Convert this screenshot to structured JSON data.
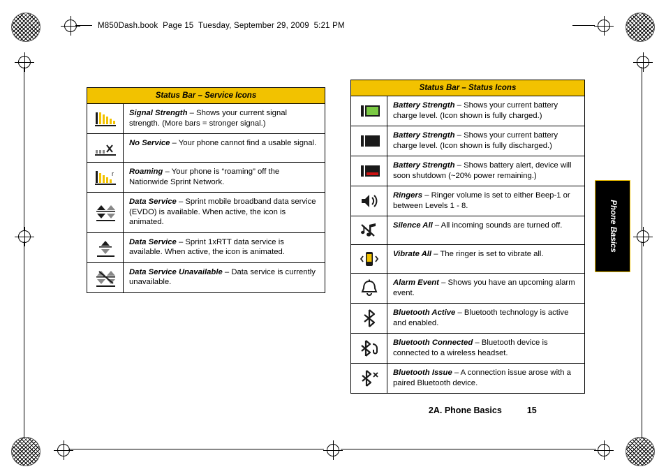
{
  "header": {
    "text": "M850Dash.book  Page 15  Tuesday, September 29, 2009  5:21 PM"
  },
  "footer": {
    "chapter": "2A. Phone Basics",
    "page_number": "15"
  },
  "side_tab": {
    "label": "Phone Basics"
  },
  "tables": [
    {
      "id": "service-icons",
      "caption": "Status Bar – Service Icons",
      "rows": [
        {
          "icon": "signal-strength-icon",
          "term": "Signal Strength",
          "desc": " – Shows your current signal strength. (More bars = stronger signal.)"
        },
        {
          "icon": "no-service-icon",
          "term": "No Service",
          "desc": " – Your phone cannot find a usable signal."
        },
        {
          "icon": "roaming-icon",
          "term": "Roaming",
          "desc": " – Your phone is “roaming” off the Nationwide Sprint Network."
        },
        {
          "icon": "data-service-evdo-icon",
          "term": "Data Service",
          "desc": " – Sprint mobile broadband data service (EVDO) is available. When active, the icon is animated."
        },
        {
          "icon": "data-service-1xrtt-icon",
          "term": "Data Service",
          "desc": " – Sprint 1xRTT data service is available. When active, the icon is animated."
        },
        {
          "icon": "data-service-unavailable-icon",
          "term": "Data Service Unavailable",
          "desc": " – Data service is currently unavailable."
        }
      ]
    },
    {
      "id": "status-icons",
      "caption": "Status Bar – Status Icons",
      "rows": [
        {
          "icon": "battery-full-icon",
          "term": "Battery Strength",
          "desc": " – Shows your current battery charge level. (Icon shown is fully charged.)"
        },
        {
          "icon": "battery-empty-icon",
          "term": "Battery Strength",
          "desc": " – Shows your current battery charge level. (Icon shown is fully discharged.)"
        },
        {
          "icon": "battery-alert-icon",
          "term": "Battery Strength",
          "desc": " – Shows battery alert, device will soon shutdown (~20% power remaining.)"
        },
        {
          "icon": "ringer-icon",
          "term": "Ringers",
          "desc": " – Ringer volume is set to either Beep-1 or between Levels 1 - 8."
        },
        {
          "icon": "silence-all-icon",
          "term": "Silence All",
          "desc": " – All incoming sounds are turned off."
        },
        {
          "icon": "vibrate-all-icon",
          "term": "Vibrate All",
          "desc": " – The ringer is set to vibrate all."
        },
        {
          "icon": "alarm-event-icon",
          "term": "Alarm Event",
          "desc": " – Shows you have an upcoming alarm event."
        },
        {
          "icon": "bluetooth-active-icon",
          "term": "Bluetooth Active",
          "desc": " – Bluetooth technology is active and enabled."
        },
        {
          "icon": "bluetooth-connected-icon",
          "term": "Bluetooth Connected",
          "desc": " – Bluetooth device is connected to a wireless headset."
        },
        {
          "icon": "bluetooth-issue-icon",
          "term": "Bluetooth Issue",
          "desc": " – A connection issue arose with a paired Bluetooth device."
        }
      ]
    }
  ],
  "colors": {
    "caption_background": "#f2c200",
    "tab_background": "#000000",
    "icon_green": "#7ac943",
    "icon_red": "#cc1111"
  }
}
